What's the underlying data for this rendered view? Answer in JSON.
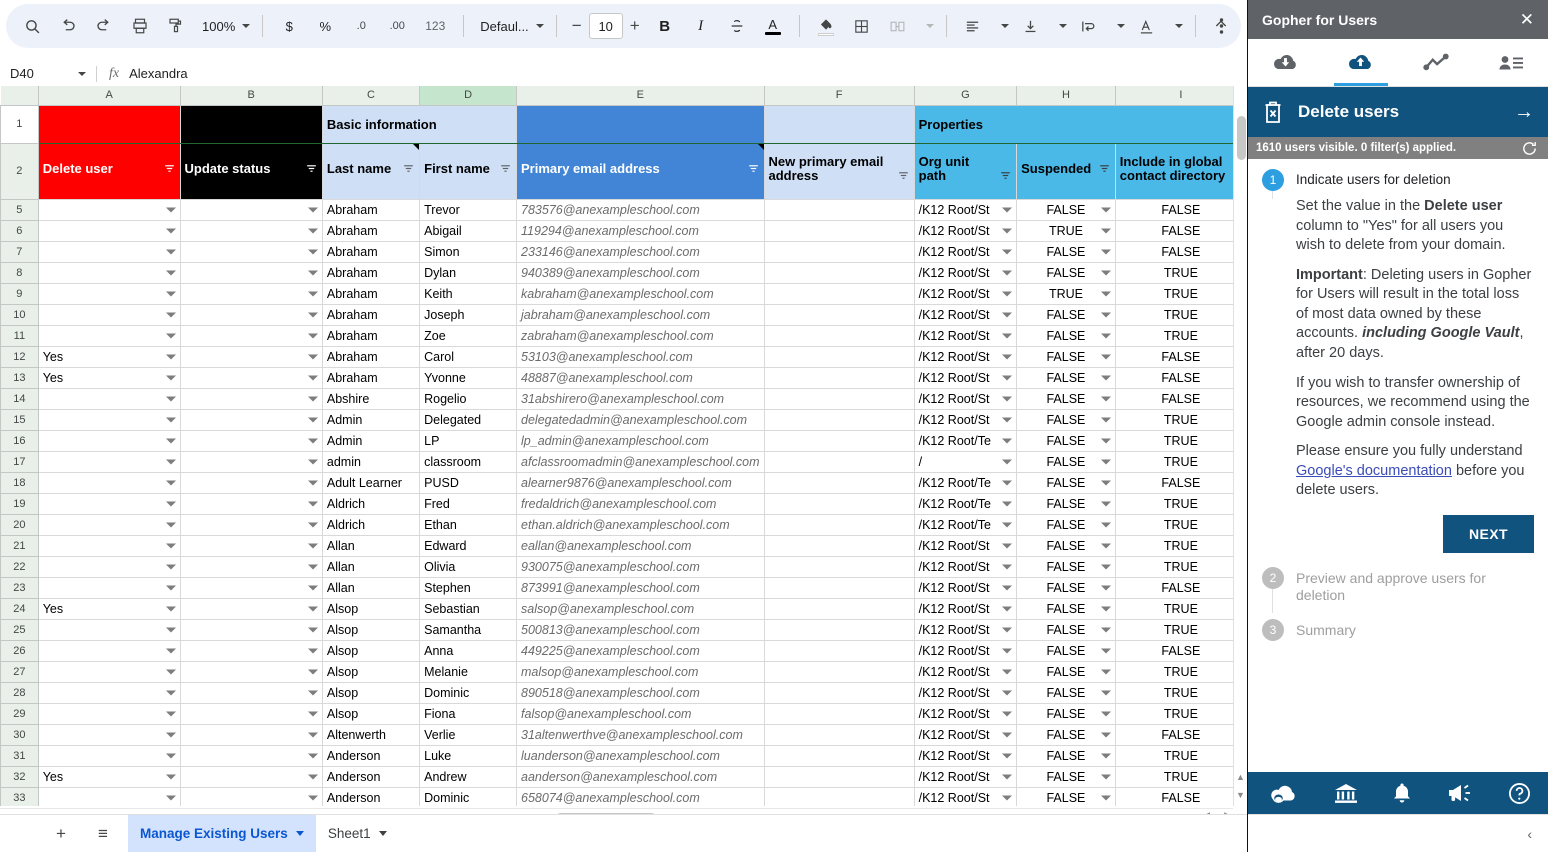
{
  "toolbar": {
    "icons": [
      "search-icon",
      "undo-icon",
      "redo-icon",
      "print-icon",
      "paint-format-icon"
    ],
    "zoom": "100%",
    "currency_label": "$",
    "percent_label": "%",
    "dec_less_label": ".0",
    "dec_more_label": ".00",
    "formats_label": "123",
    "font_name": "Defaul...",
    "font_size": "10",
    "bold_label": "B",
    "italic_label": "I",
    "strikethrough_label": "S",
    "text_color_label": "A",
    "decrease_label": "−",
    "increase_label": "+"
  },
  "formula_bar": {
    "cell_ref": "D40",
    "fx_label": "fx",
    "value": "Alexandra"
  },
  "grid": {
    "columns": [
      "A",
      "B",
      "C",
      "D",
      "E",
      "F",
      "G",
      "H",
      "I"
    ],
    "selected_column": "D",
    "banner": {
      "basic_information": "Basic information",
      "properties": "Properties"
    },
    "headers": [
      "Delete user",
      "Update status",
      "Last name",
      "First name",
      "Primary email address",
      "New primary email address",
      "Org unit path",
      "Suspended",
      "Include in global contact directory"
    ],
    "rows": [
      {
        "n": "5",
        "delete": "",
        "status": "",
        "last": "Abraham",
        "first": "Trevor",
        "email": "783576@anexampleschool.com",
        "newemail": "",
        "ou": "/K12 Root/St",
        "susp": "FALSE",
        "gcd": "FALSE"
      },
      {
        "n": "6",
        "delete": "",
        "status": "",
        "last": "Abraham",
        "first": "Abigail",
        "email": "119294@anexampleschool.com",
        "newemail": "",
        "ou": "/K12 Root/St",
        "susp": "TRUE",
        "gcd": "FALSE"
      },
      {
        "n": "7",
        "delete": "",
        "status": "",
        "last": "Abraham",
        "first": "Simon",
        "email": "233146@anexampleschool.com",
        "newemail": "",
        "ou": "/K12 Root/St",
        "susp": "FALSE",
        "gcd": "FALSE"
      },
      {
        "n": "8",
        "delete": "",
        "status": "",
        "last": "Abraham",
        "first": "Dylan",
        "email": "940389@anexampleschool.com",
        "newemail": "",
        "ou": "/K12 Root/St",
        "susp": "FALSE",
        "gcd": "TRUE"
      },
      {
        "n": "9",
        "delete": "",
        "status": "",
        "last": "Abraham",
        "first": "Keith",
        "email": "kabraham@anexampleschool.com",
        "newemail": "",
        "ou": "/K12 Root/St",
        "susp": "TRUE",
        "gcd": "TRUE"
      },
      {
        "n": "10",
        "delete": "",
        "status": "",
        "last": "Abraham",
        "first": "Joseph",
        "email": "jabraham@anexampleschool.com",
        "newemail": "",
        "ou": "/K12 Root/St",
        "susp": "FALSE",
        "gcd": "TRUE"
      },
      {
        "n": "11",
        "delete": "",
        "status": "",
        "last": "Abraham",
        "first": "Zoe",
        "email": "zabraham@anexampleschool.com",
        "newemail": "",
        "ou": "/K12 Root/St",
        "susp": "FALSE",
        "gcd": "TRUE"
      },
      {
        "n": "12",
        "delete": "Yes",
        "status": "",
        "last": "Abraham",
        "first": "Carol",
        "email": "53103@anexampleschool.com",
        "newemail": "",
        "ou": "/K12 Root/St",
        "susp": "FALSE",
        "gcd": "FALSE"
      },
      {
        "n": "13",
        "delete": "Yes",
        "status": "",
        "last": "Abraham",
        "first": "Yvonne",
        "email": "48887@anexampleschool.com",
        "newemail": "",
        "ou": "/K12 Root/St",
        "susp": "FALSE",
        "gcd": "FALSE"
      },
      {
        "n": "14",
        "delete": "",
        "status": "",
        "last": "Abshire",
        "first": "Rogelio",
        "email": "31abshirero@anexampleschool.com",
        "newemail": "",
        "ou": "/K12 Root/St",
        "susp": "FALSE",
        "gcd": "FALSE"
      },
      {
        "n": "15",
        "delete": "",
        "status": "",
        "last": "Admin",
        "first": "Delegated",
        "email": "delegatedadmin@anexampleschool.com",
        "newemail": "",
        "ou": "/K12 Root/St",
        "susp": "FALSE",
        "gcd": "TRUE"
      },
      {
        "n": "16",
        "delete": "",
        "status": "",
        "last": "Admin",
        "first": "LP",
        "email": "lp_admin@anexampleschool.com",
        "newemail": "",
        "ou": "/K12 Root/Te",
        "susp": "FALSE",
        "gcd": "TRUE"
      },
      {
        "n": "17",
        "delete": "",
        "status": "",
        "last": "admin",
        "first": "classroom",
        "email": "afclassroomadmin@anexampleschool.com",
        "newemail": "",
        "ou": "/",
        "susp": "FALSE",
        "gcd": "TRUE"
      },
      {
        "n": "18",
        "delete": "",
        "status": "",
        "last": "Adult Learner",
        "first": "PUSD",
        "email": "alearner9876@anexampleschool.com",
        "newemail": "",
        "ou": "/K12 Root/Te",
        "susp": "FALSE",
        "gcd": "FALSE"
      },
      {
        "n": "19",
        "delete": "",
        "status": "",
        "last": "Aldrich",
        "first": "Fred",
        "email": "fredaldrich@anexampleschool.com",
        "newemail": "",
        "ou": "/K12 Root/Te",
        "susp": "FALSE",
        "gcd": "TRUE"
      },
      {
        "n": "20",
        "delete": "",
        "status": "",
        "last": "Aldrich",
        "first": "Ethan",
        "email": "ethan.aldrich@anexampleschool.com",
        "newemail": "",
        "ou": "/K12 Root/Te",
        "susp": "FALSE",
        "gcd": "TRUE"
      },
      {
        "n": "21",
        "delete": "",
        "status": "",
        "last": "Allan",
        "first": "Edward",
        "email": "eallan@anexampleschool.com",
        "newemail": "",
        "ou": "/K12 Root/St",
        "susp": "FALSE",
        "gcd": "TRUE"
      },
      {
        "n": "22",
        "delete": "",
        "status": "",
        "last": "Allan",
        "first": "Olivia",
        "email": "930075@anexampleschool.com",
        "newemail": "",
        "ou": "/K12 Root/St",
        "susp": "FALSE",
        "gcd": "TRUE"
      },
      {
        "n": "23",
        "delete": "",
        "status": "",
        "last": "Allan",
        "first": "Stephen",
        "email": "873991@anexampleschool.com",
        "newemail": "",
        "ou": "/K12 Root/St",
        "susp": "FALSE",
        "gcd": "FALSE"
      },
      {
        "n": "24",
        "delete": "Yes",
        "status": "",
        "last": "Alsop",
        "first": "Sebastian",
        "email": "salsop@anexampleschool.com",
        "newemail": "",
        "ou": "/K12 Root/St",
        "susp": "FALSE",
        "gcd": "TRUE"
      },
      {
        "n": "25",
        "delete": "",
        "status": "",
        "last": "Alsop",
        "first": "Samantha",
        "email": "500813@anexampleschool.com",
        "newemail": "",
        "ou": "/K12 Root/St",
        "susp": "FALSE",
        "gcd": "TRUE"
      },
      {
        "n": "26",
        "delete": "",
        "status": "",
        "last": "Alsop",
        "first": "Anna",
        "email": "449225@anexampleschool.com",
        "newemail": "",
        "ou": "/K12 Root/St",
        "susp": "FALSE",
        "gcd": "FALSE"
      },
      {
        "n": "27",
        "delete": "",
        "status": "",
        "last": "Alsop",
        "first": "Melanie",
        "email": "malsop@anexampleschool.com",
        "newemail": "",
        "ou": "/K12 Root/St",
        "susp": "FALSE",
        "gcd": "TRUE"
      },
      {
        "n": "28",
        "delete": "",
        "status": "",
        "last": "Alsop",
        "first": "Dominic",
        "email": "890518@anexampleschool.com",
        "newemail": "",
        "ou": "/K12 Root/St",
        "susp": "FALSE",
        "gcd": "TRUE"
      },
      {
        "n": "29",
        "delete": "",
        "status": "",
        "last": "Alsop",
        "first": "Fiona",
        "email": "falsop@anexampleschool.com",
        "newemail": "",
        "ou": "/K12 Root/St",
        "susp": "FALSE",
        "gcd": "TRUE"
      },
      {
        "n": "30",
        "delete": "",
        "status": "",
        "last": "Altenwerth",
        "first": "Verlie",
        "email": "31altenwerthve@anexampleschool.com",
        "newemail": "",
        "ou": "/K12 Root/St",
        "susp": "FALSE",
        "gcd": "FALSE"
      },
      {
        "n": "31",
        "delete": "",
        "status": "",
        "last": "Anderson",
        "first": "Luke",
        "email": "luanderson@anexampleschool.com",
        "newemail": "",
        "ou": "/K12 Root/St",
        "susp": "FALSE",
        "gcd": "TRUE"
      },
      {
        "n": "32",
        "delete": "Yes",
        "status": "",
        "last": "Anderson",
        "first": "Andrew",
        "email": "aanderson@anexampleschool.com",
        "newemail": "",
        "ou": "/K12 Root/St",
        "susp": "FALSE",
        "gcd": "TRUE"
      },
      {
        "n": "33",
        "delete": "",
        "status": "",
        "last": "Anderson",
        "first": "Dominic",
        "email": "658074@anexampleschool.com",
        "newemail": "",
        "ou": "/K12 Root/St",
        "susp": "FALSE",
        "gcd": "FALSE"
      }
    ]
  },
  "sheet_tabs": {
    "add_label": "+",
    "all_sheets_label": "≡",
    "tabs": [
      {
        "label": "Manage Existing Users",
        "active": true
      },
      {
        "label": "Sheet1",
        "active": false
      }
    ]
  },
  "sidebar": {
    "title": "Gopher for Users",
    "tabs": [
      {
        "icon": "cloud-download-icon",
        "active": false
      },
      {
        "icon": "cloud-upload-icon",
        "active": true
      },
      {
        "icon": "chart-line-icon",
        "active": false
      },
      {
        "icon": "user-list-icon",
        "active": false
      }
    ],
    "banner": {
      "icon": "trash-delete-icon",
      "title": "Delete users",
      "arrow": "→"
    },
    "status": {
      "text": "1610 users visible.  0 filter(s) applied.",
      "refresh_icon": "refresh-icon"
    },
    "steps": [
      {
        "num": "1",
        "title": "Indicate users for deletion",
        "state": "active"
      },
      {
        "num": "2",
        "title": "Preview and approve users for deletion",
        "state": "idle"
      },
      {
        "num": "3",
        "title": "Summary",
        "state": "idle"
      }
    ],
    "paragraphs": {
      "p1_a": "Set the value in the ",
      "p1_b": "Delete user",
      "p1_c": " column to \"Yes\" for all users you wish to delete from your domain.",
      "p2_a": "Important",
      "p2_b": ": Deleting users in Gopher for Users will result in the total loss of most data owned by these accounts. ",
      "p2_c": "including Google Vault",
      "p2_d": ", after 20 days.",
      "p3": "If you wish to transfer ownership of resources, we recommend using the Google admin console instead.",
      "p4_a": "Please ensure you fully understand ",
      "p4_link": "Google's documentation",
      "p4_b": " before you delete users."
    },
    "next_label": "NEXT",
    "footer_icons": [
      "gopher-cloud-icon",
      "bank-icon",
      "bell-icon",
      "megaphone-icon",
      "help-icon"
    ],
    "collapse_icon": "‹"
  }
}
